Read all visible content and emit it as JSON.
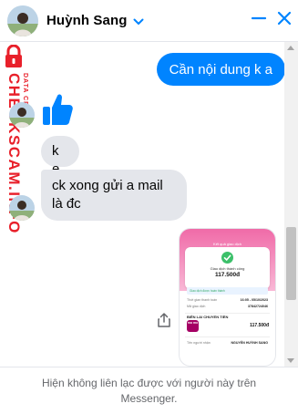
{
  "header": {
    "contact_name": "Huỳnh Sang",
    "minimize_label": "minimize",
    "close_label": "close"
  },
  "watermark": {
    "main": "CHECKSCAM.INFO",
    "sub": "DATA CENTER"
  },
  "messages": {
    "outgoing_1": "Cần nội dung k a",
    "incoming_1": "k e",
    "incoming_2": "ck xong gửi a mail là đc"
  },
  "receipt": {
    "header_title": "Kết quả giao dịch",
    "status_label": "Giao dịch thành công",
    "amount": "117.500đ",
    "rows": [
      {
        "label": "Thời gian thanh toán",
        "value": "16:05 - 05/10/2023"
      },
      {
        "label": "Mã giao dịch",
        "value": "37842724046"
      }
    ],
    "mini_banner": "Giao dịch được hoàn thành",
    "section_title": "BIÊN LAI CHUYỂN TIỀN",
    "logo_text": "mo mo",
    "amount_2": "117.500đ",
    "recipient_label": "Tên người nhận",
    "recipient_value": "NGUYỄN HUỲNH SANG"
  },
  "footer": {
    "notice": "Hiện không liên lạc được với người này trên Messenger."
  },
  "colors": {
    "accent": "#0084ff",
    "bubble_in": "#e4e6eb",
    "watermark": "#e8202a",
    "momo": "#a50064"
  }
}
